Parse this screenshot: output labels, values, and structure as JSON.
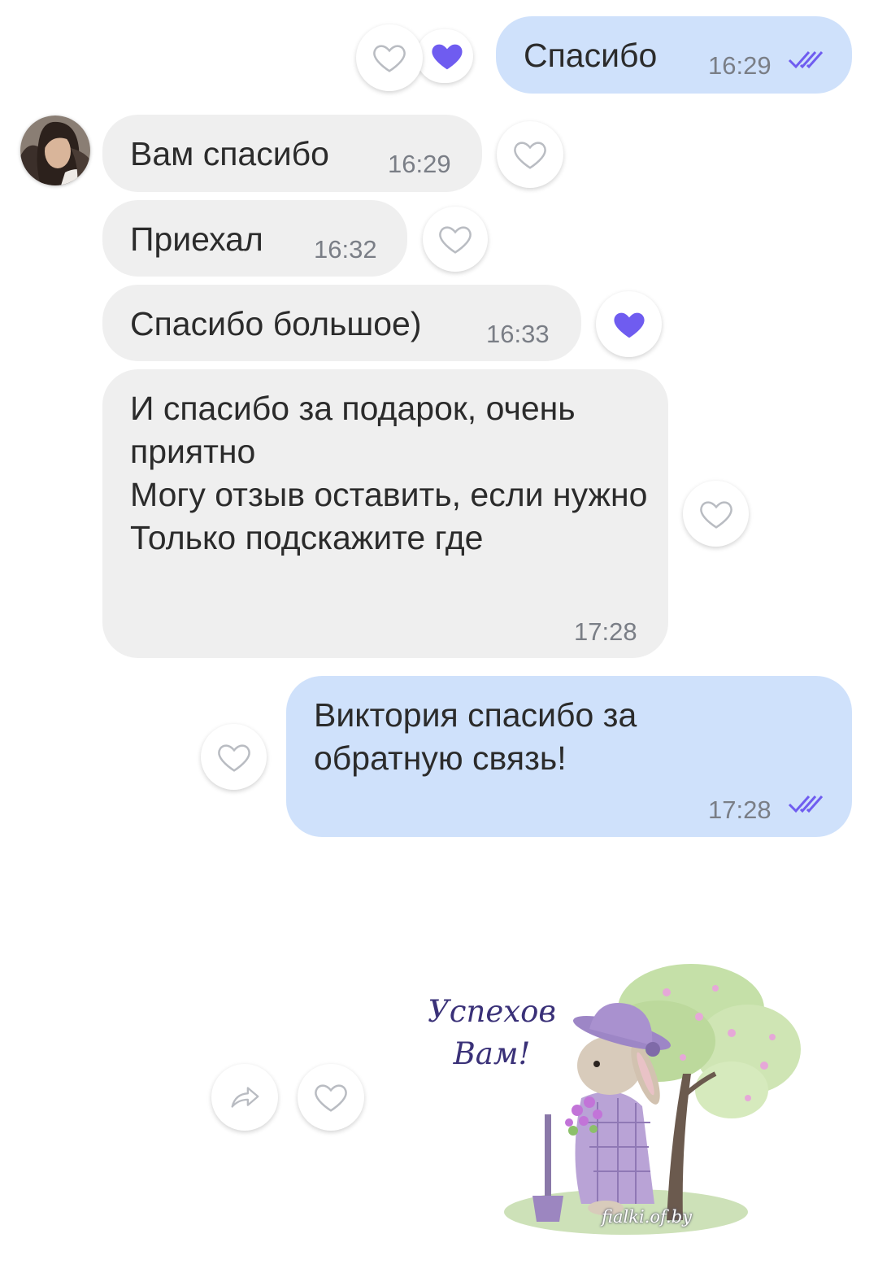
{
  "colors": {
    "incoming_bubble": "#efefef",
    "outgoing_bubble": "#cfe1fb",
    "accent_heart": "#6f5cf0",
    "ticks": "#6f5cf0"
  },
  "messages": [
    {
      "direction": "outgoing",
      "text": "Спасибо",
      "time": "16:29",
      "status_icon": "double-check-icon",
      "reaction": "filled-heart"
    },
    {
      "direction": "incoming",
      "text": "Вам спасибо",
      "time": "16:29",
      "reaction": "empty-heart"
    },
    {
      "direction": "incoming",
      "text": "Приехал",
      "time": "16:32",
      "reaction": "empty-heart"
    },
    {
      "direction": "incoming",
      "text": "Спасибо большое)",
      "time": "16:33",
      "reaction": "filled-heart"
    },
    {
      "direction": "incoming",
      "text": "И спасибо за подарок, очень приятно\nМогу отзыв оставить, если нужно\nТолько подскажите где",
      "time": "17:28",
      "reaction": "empty-heart"
    },
    {
      "direction": "outgoing",
      "text": "Виктория спасибо за обратную связь!",
      "time": "17:28",
      "status_icon": "double-check-icon",
      "reaction": "empty-heart"
    }
  ],
  "sticker": {
    "caption_line1": "Успехов",
    "caption_line2": "Вам!",
    "watermark": "fialki.of.by"
  },
  "icons": {
    "share": "share-arrow-icon",
    "like": "heart-outline-icon"
  }
}
